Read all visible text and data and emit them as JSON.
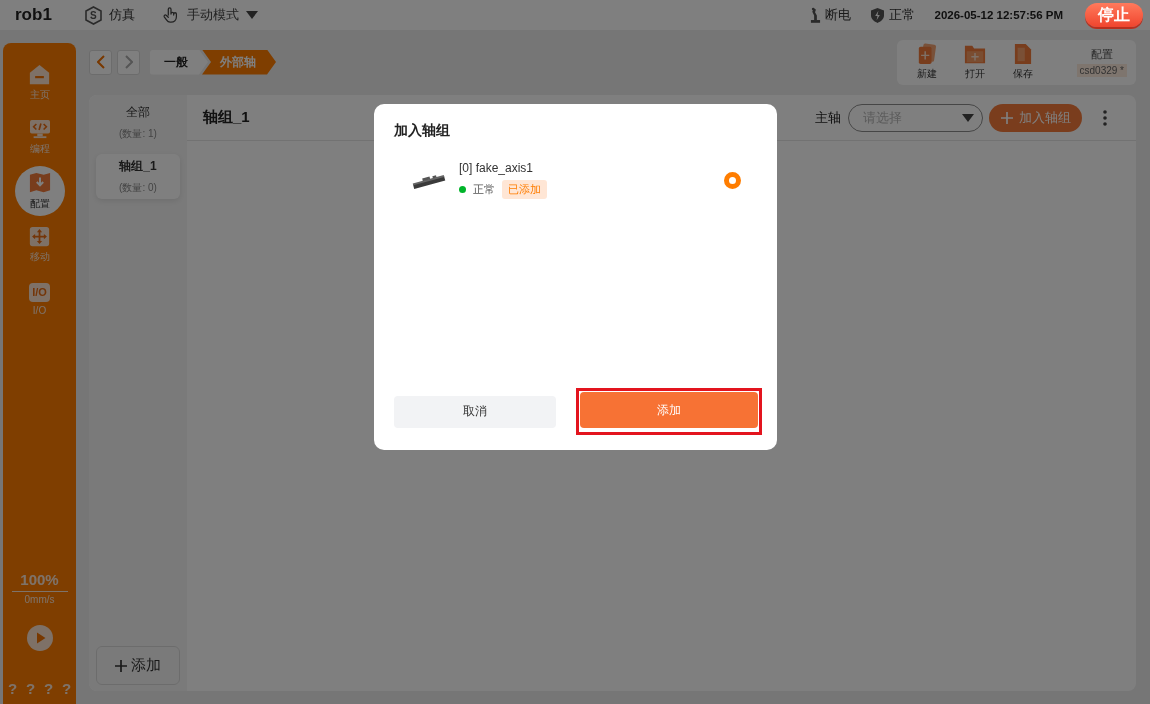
{
  "top_bar": {
    "title": "rob1",
    "mode_badge": "S",
    "mode": "仿真",
    "operation_mode": "手动模式",
    "power_status": "断电",
    "safety_status": "正常",
    "datetime": "2026-05-12 12:57:56 PM",
    "stop_button": "停止"
  },
  "sidebar": {
    "items": [
      {
        "label": "主页",
        "kind": "home",
        "selected": false
      },
      {
        "label": "编程",
        "kind": "code",
        "selected": false
      },
      {
        "label": "配置",
        "kind": "config",
        "selected": true
      },
      {
        "label": "移动",
        "kind": "move",
        "selected": false
      },
      {
        "label": "I/O",
        "kind": "io",
        "icon_text": "I/O",
        "selected": false
      }
    ],
    "speed": "100%",
    "velocity": "0mm/s",
    "status_marks": [
      "?",
      "?",
      "?",
      "?"
    ]
  },
  "nav_buttons": [
    {
      "kind": "back",
      "disabled": false
    },
    {
      "kind": "forward",
      "disabled": true
    }
  ],
  "breadcrumb": [
    {
      "label": "一般",
      "selected": false
    },
    {
      "label": "外部轴",
      "selected": true
    }
  ],
  "file_toolbar": {
    "buttons": [
      {
        "label": "新建",
        "kind": "new"
      },
      {
        "label": "打开",
        "kind": "open"
      },
      {
        "label": "保存",
        "kind": "save"
      }
    ],
    "config_label": "配置",
    "config_name": "csd0329 *"
  },
  "group_list": {
    "items": [
      {
        "label": "全部",
        "count": "(数量: 1)",
        "selected": false
      },
      {
        "label": "轴组_1",
        "count": "(数量: 0)",
        "selected": true
      }
    ],
    "add_button": "添加"
  },
  "group_panel": {
    "title": "轴组_1",
    "main_axis_label": "主轴",
    "main_axis_select": {
      "placeholder": "请选择"
    },
    "add_axis_button": "加入轴组"
  },
  "dialog": {
    "title": "加入轴组",
    "axes": [
      {
        "name": "[0] fake_axis1",
        "status": "正常",
        "color": "#00b42a",
        "tag": "已添加",
        "selected": true
      }
    ],
    "buttons": [
      {
        "label": "取消",
        "kind": "secondary"
      },
      {
        "label": "添加",
        "kind": "primary",
        "highlighted": true
      }
    ]
  }
}
